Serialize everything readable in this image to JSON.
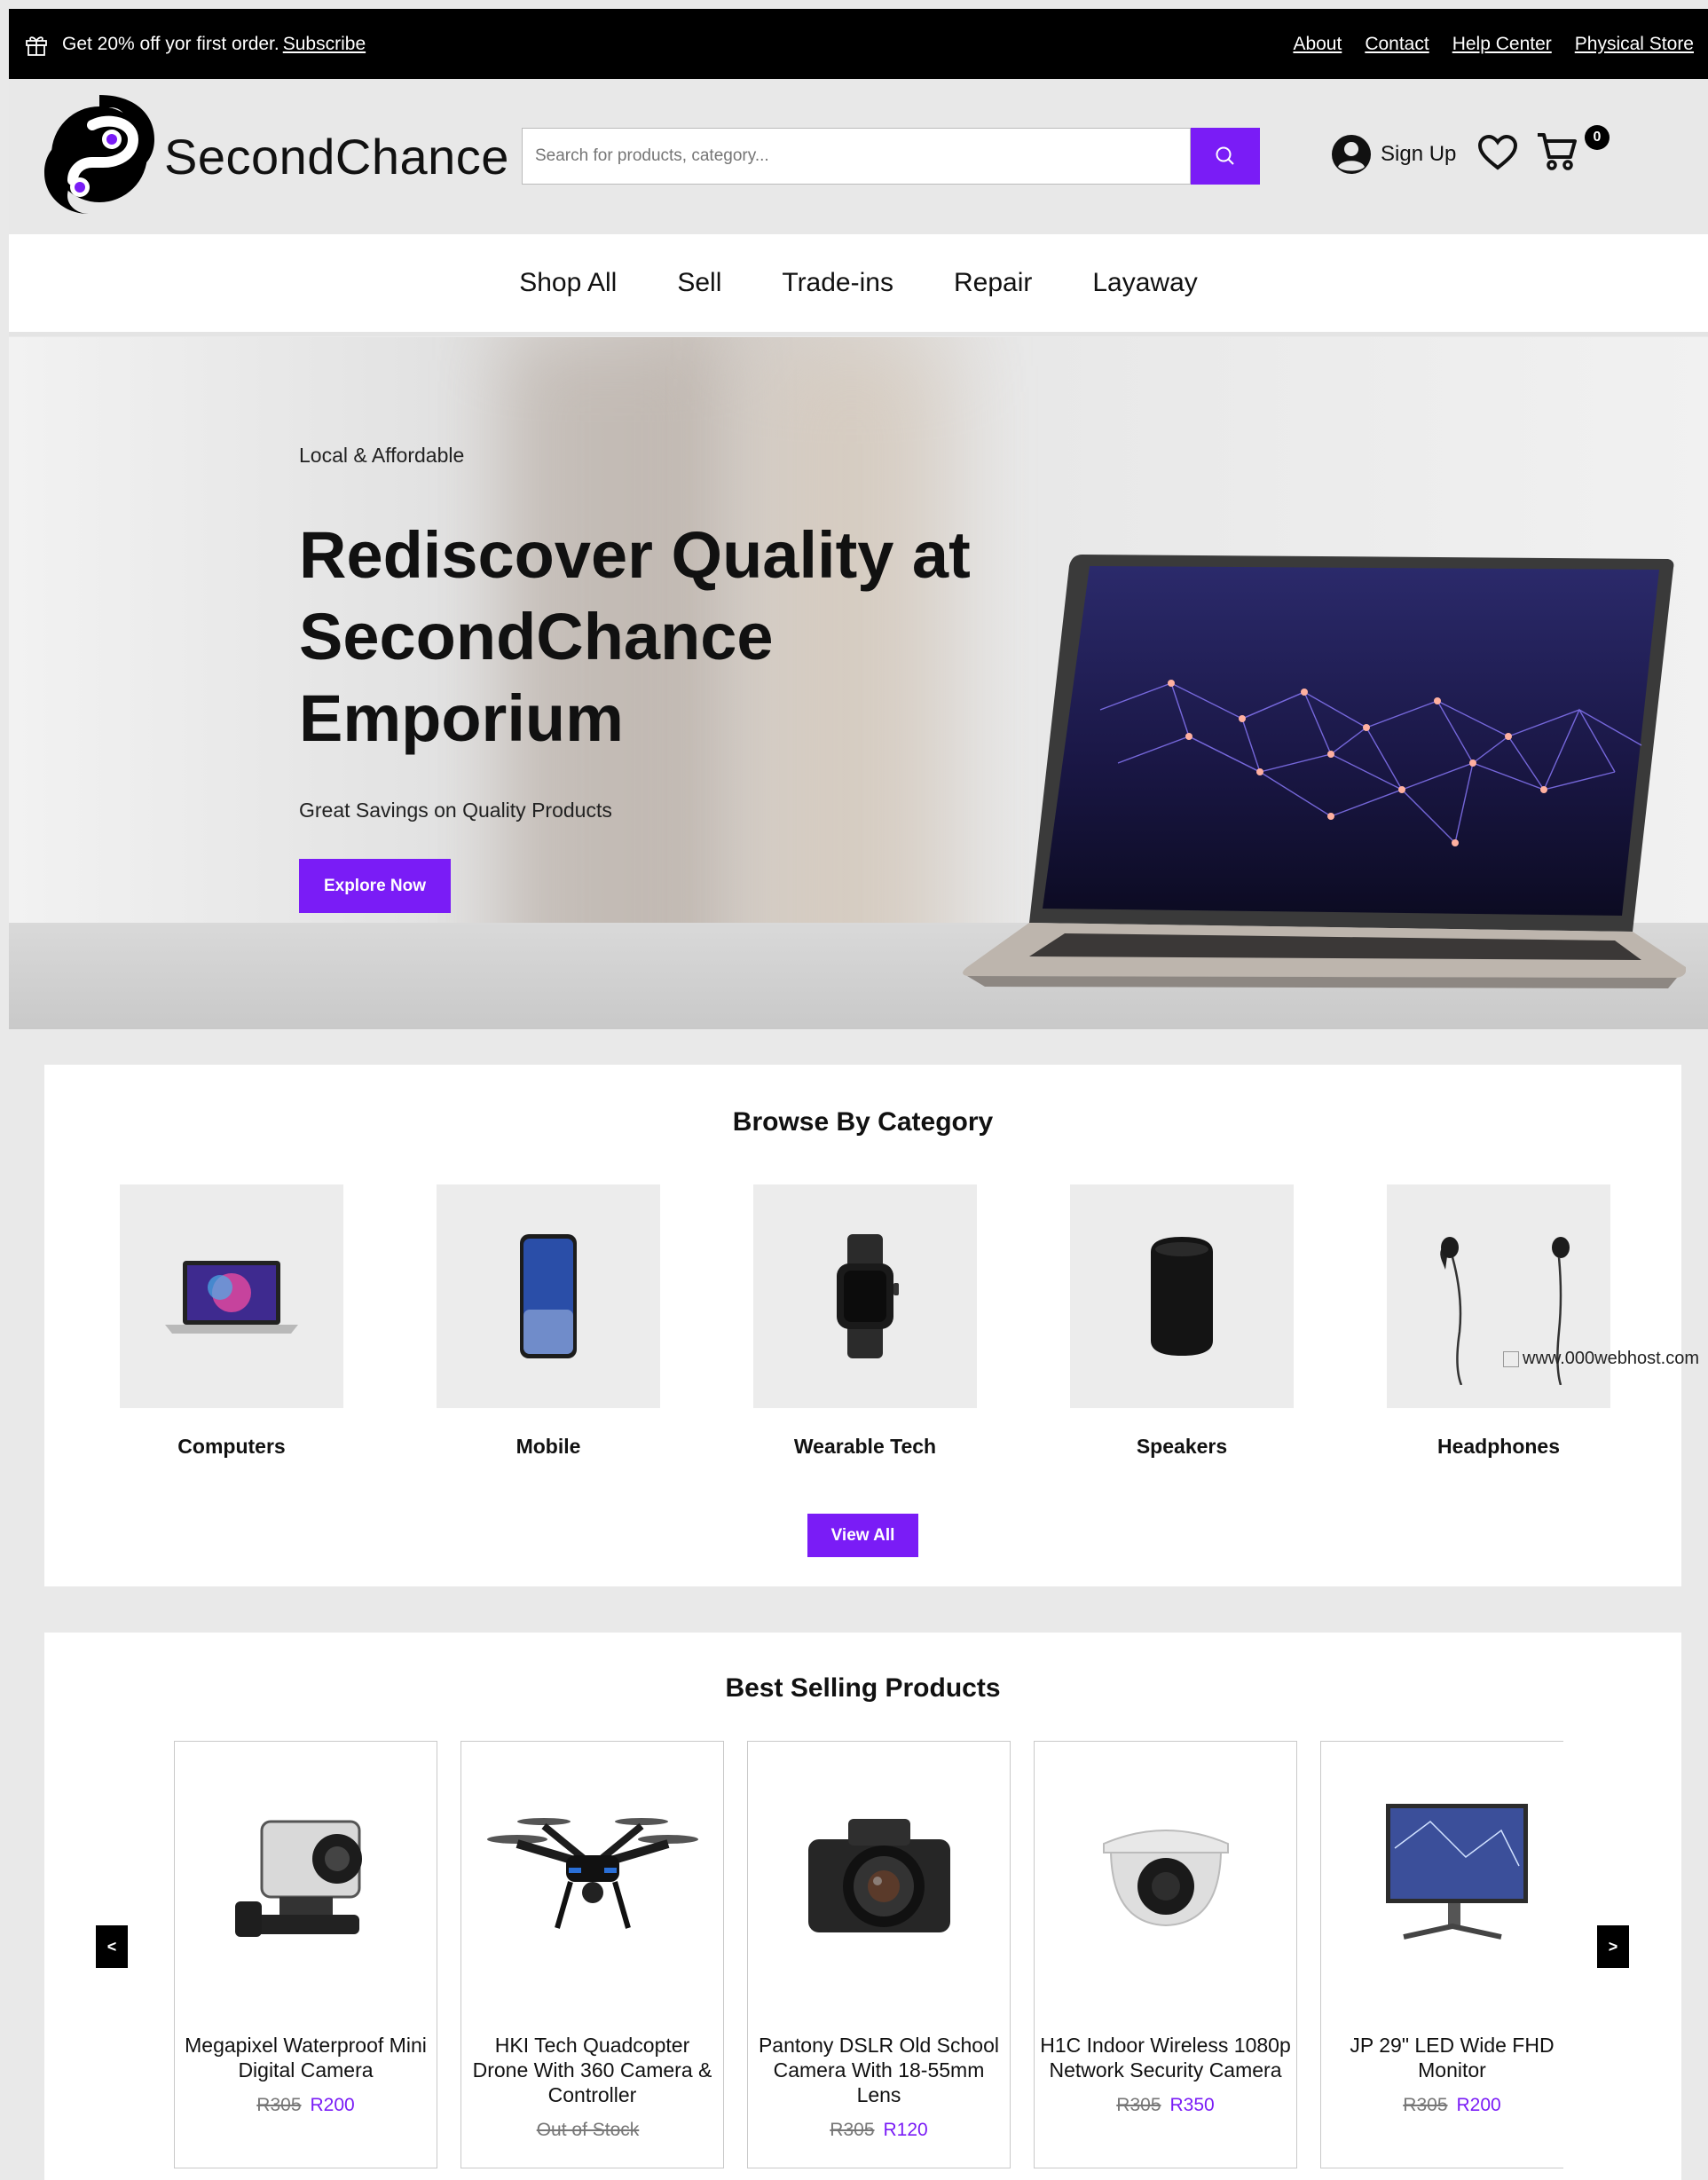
{
  "promo": {
    "text": "Get 20% off yor first order.",
    "link": "Subscribe"
  },
  "top_links": [
    "About",
    "Contact",
    "Help Center",
    "Physical Store"
  ],
  "brand": {
    "name": "SecondChance",
    "accent": "#7a1cf6"
  },
  "search": {
    "placeholder": "Search for products, category..."
  },
  "account": {
    "signup": "Sign Up"
  },
  "cart": {
    "count": "0"
  },
  "nav": [
    "Shop All",
    "Sell",
    "Trade-ins",
    "Repair",
    "Layaway"
  ],
  "hero": {
    "eyebrow": "Local & Affordable",
    "title": "Rediscover Quality at SecondChance Emporium",
    "subtitle": "Great Savings on Quality Products",
    "cta": "Explore Now"
  },
  "categories": {
    "title": "Browse By Category",
    "items": [
      "Computers",
      "Mobile",
      "Wearable Tech",
      "Speakers",
      "Headphones"
    ],
    "view_all": "View All"
  },
  "broken_image_alt": "www.000webhost.com",
  "best_selling": {
    "title": "Best Selling Products",
    "prev": "<",
    "next": ">",
    "products": [
      {
        "name": "Megapixel Waterproof Mini Digital Camera",
        "old_price": "R305",
        "price": "R200"
      },
      {
        "name": "HKI Tech Quadcopter Drone With 360 Camera & Controller",
        "old_price": "Out of Stock",
        "price": ""
      },
      {
        "name": "Pantony DSLR Old School Camera With 18-55mm Lens",
        "old_price": "R305",
        "price": "R120"
      },
      {
        "name": "H1C Indoor Wireless 1080p Network Security Camera",
        "old_price": "R305",
        "price": "R350"
      },
      {
        "name": "JP 29\" LED Wide FHD Monitor",
        "old_price": "R305",
        "price": "R200"
      }
    ]
  }
}
